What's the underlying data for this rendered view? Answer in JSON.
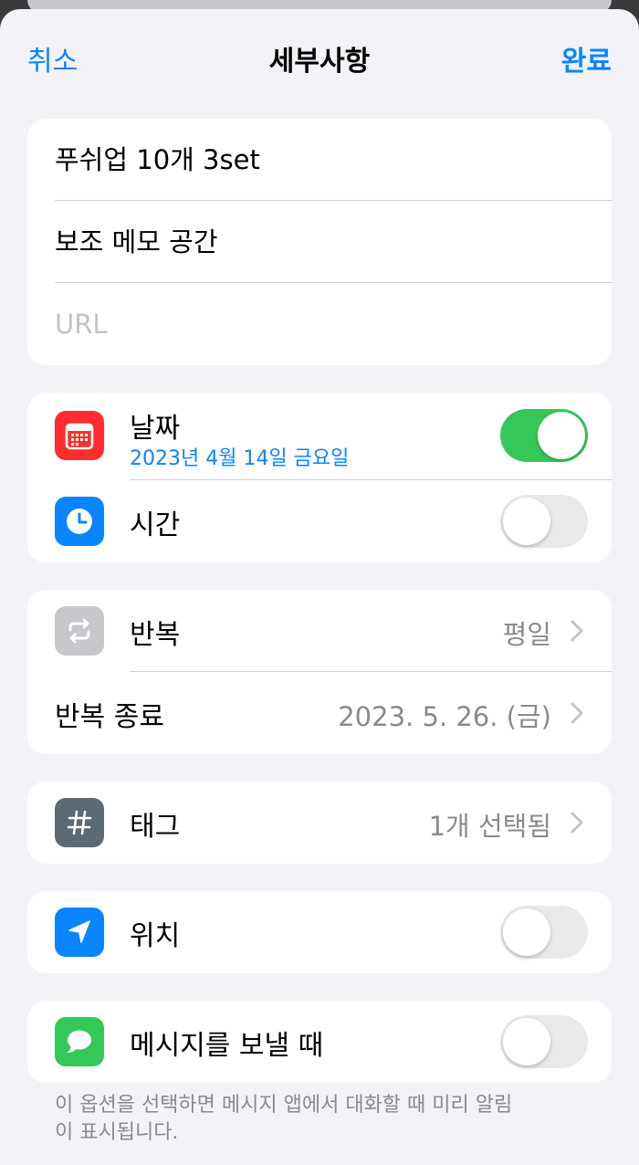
{
  "nav": {
    "cancel": "취소",
    "title": "세부사항",
    "done": "완료"
  },
  "details": {
    "title_value": "푸쉬업 10개 3set",
    "notes_value": "보조 메모 공간",
    "url_placeholder": "URL"
  },
  "date_time": {
    "date_label": "날짜",
    "date_value": "2023년 4월 14일 금요일",
    "date_enabled": true,
    "time_label": "시간",
    "time_enabled": false,
    "date_icon": "calendar-icon",
    "time_icon": "clock-icon"
  },
  "repeat": {
    "label": "반복",
    "value": "평일",
    "icon": "repeat-icon",
    "end_label": "반복 종료",
    "end_value": "2023. 5. 26. (금)"
  },
  "tags": {
    "label": "태그",
    "value": "1개 선택됨",
    "icon": "hashtag-icon"
  },
  "location": {
    "label": "위치",
    "enabled": false,
    "icon": "location-arrow-icon"
  },
  "messaging": {
    "label": "메시지를 보낼 때",
    "enabled": false,
    "icon": "message-bubble-icon",
    "footnote": "이 옵션을 선택하면 메시지 앱에서 대화할 때 미리 알림이 표시됩니다."
  },
  "colors": {
    "accent": "#0a84ff",
    "toggle_on": "#34c759",
    "calendar_icon_bg": "#ff2d2d",
    "clock_icon_bg": "#0a84ff",
    "repeat_icon_bg": "#c7c7cc",
    "tag_icon_bg": "#5c6a73",
    "location_icon_bg": "#0a84ff",
    "message_icon_bg": "#34c759"
  }
}
